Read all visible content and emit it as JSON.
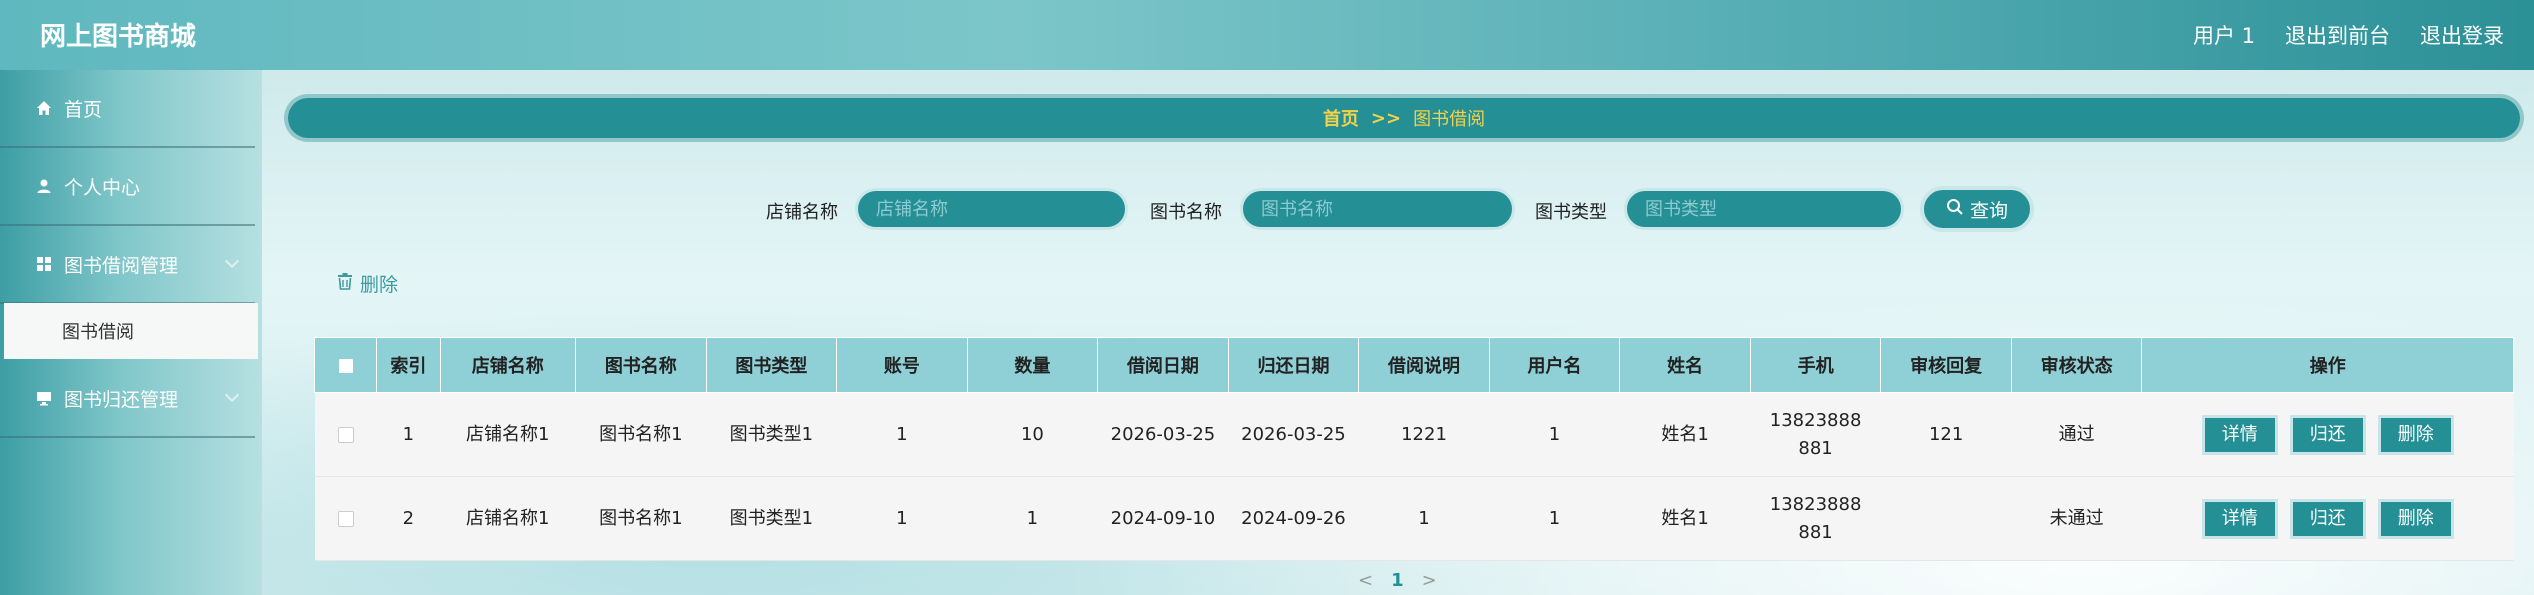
{
  "header": {
    "brand": "网上图书商城",
    "nav": [
      "用户 1",
      "退出到前台",
      "退出登录"
    ]
  },
  "sidebar": {
    "items": [
      {
        "label": "首页",
        "icon": "home-icon"
      },
      {
        "label": "个人中心",
        "icon": "user-icon"
      },
      {
        "label": "图书借阅管理",
        "icon": "grid-icon"
      },
      {
        "label": "图书归还管理",
        "icon": "monitor-icon"
      }
    ],
    "active_sub": "图书借阅"
  },
  "breadcrumb": {
    "home": "首页",
    "sep": ">>",
    "current": "图书借阅"
  },
  "search": {
    "fields": [
      {
        "label": "店铺名称",
        "placeholder": "店铺名称"
      },
      {
        "label": "图书名称",
        "placeholder": "图书名称"
      },
      {
        "label": "图书类型",
        "placeholder": "图书类型"
      }
    ],
    "button": "查询"
  },
  "toolbar": {
    "delete_label": "删除"
  },
  "table": {
    "headers": [
      "",
      "索引",
      "店铺名称",
      "图书名称",
      "图书类型",
      "账号",
      "数量",
      "借阅日期",
      "归还日期",
      "借阅说明",
      "用户名",
      "姓名",
      "手机",
      "审核回复",
      "审核状态",
      "操作"
    ],
    "rows": [
      [
        "",
        "1",
        "店铺名称1",
        "图书名称1",
        "图书类型1",
        "1",
        "10",
        "2026-03-25",
        "2026-03-25",
        "1221",
        "1",
        "姓名1",
        "13823888881",
        "121",
        "通过",
        ""
      ],
      [
        "",
        "2",
        "店铺名称1",
        "图书名称1",
        "图书类型1",
        "1",
        "1",
        "2024-09-10",
        "2024-09-26",
        "1",
        "1",
        "姓名1",
        "13823888881",
        "",
        "未通过",
        ""
      ]
    ],
    "actions": [
      "详情",
      "归还",
      "删除"
    ]
  },
  "pager": {
    "prev": "<",
    "current": "1",
    "next": ">"
  }
}
